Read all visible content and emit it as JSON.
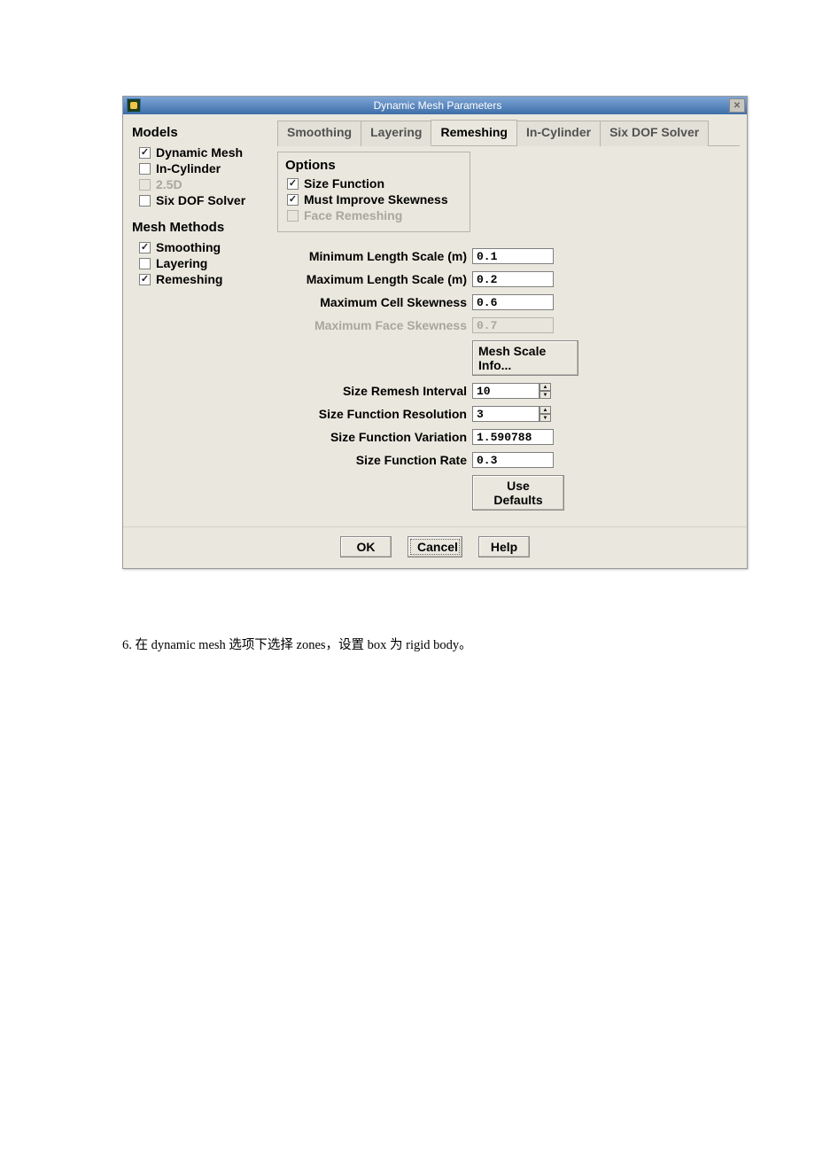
{
  "dialog": {
    "title": "Dynamic Mesh Parameters"
  },
  "sidebar": {
    "models_title": "Models",
    "models": {
      "dynamic_mesh": "Dynamic Mesh",
      "in_cylinder": "In-Cylinder",
      "two_five_d": "2.5D",
      "six_dof": "Six DOF Solver"
    },
    "methods_title": "Mesh Methods",
    "methods": {
      "smoothing": "Smoothing",
      "layering": "Layering",
      "remeshing": "Remeshing"
    }
  },
  "tabs": {
    "smoothing": "Smoothing",
    "layering": "Layering",
    "remeshing": "Remeshing",
    "in_cylinder": "In-Cylinder",
    "six_dof": "Six DOF Solver"
  },
  "options": {
    "title": "Options",
    "size_function": "Size Function",
    "must_improve": "Must Improve Skewness",
    "face_remeshing": "Face Remeshing"
  },
  "fields": {
    "min_length_label": "Minimum Length Scale (m)",
    "min_length_value": "0.1",
    "max_length_label": "Maximum Length Scale (m)",
    "max_length_value": "0.2",
    "max_cell_skew_label": "Maximum Cell Skewness",
    "max_cell_skew_value": "0.6",
    "max_face_skew_label": "Maximum Face Skewness",
    "max_face_skew_value": "0.7",
    "mesh_scale_info": "Mesh Scale Info...",
    "size_remesh_interval_label": "Size Remesh Interval",
    "size_remesh_interval_value": "10",
    "size_func_res_label": "Size Function Resolution",
    "size_func_res_value": "3",
    "size_func_var_label": "Size Function Variation",
    "size_func_var_value": "1.590788",
    "size_func_rate_label": "Size Function Rate",
    "size_func_rate_value": "0.3",
    "use_defaults": "Use Defaults"
  },
  "buttons": {
    "ok": "OK",
    "cancel": "Cancel",
    "help": "Help"
  },
  "caption": "6. 在 dynamic mesh 选项下选择 zones，设置 box 为 rigid body。"
}
